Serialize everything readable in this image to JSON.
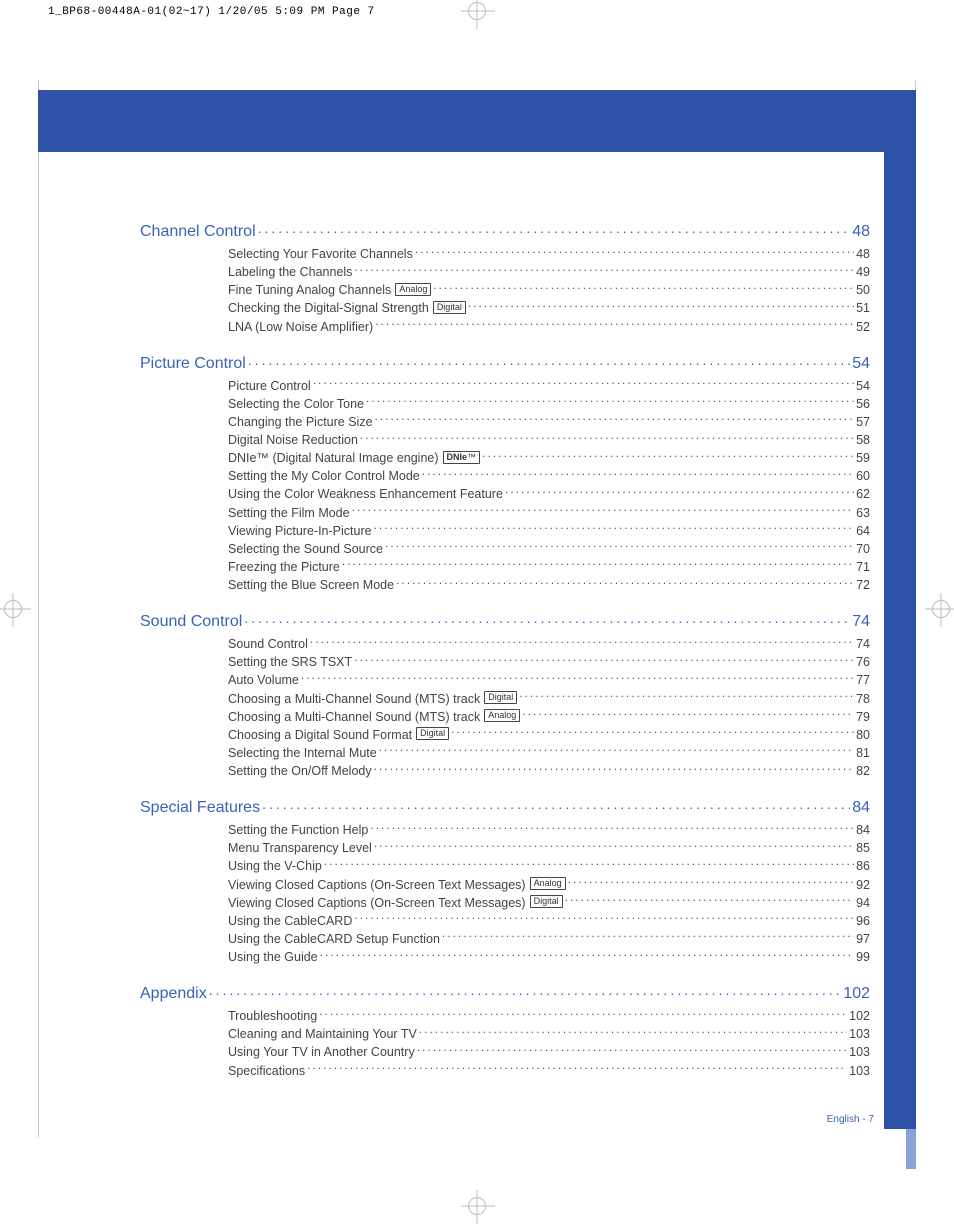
{
  "printHeader": "1_BP68-00448A-01(02~17)  1/20/05  5:09 PM  Page 7",
  "footer": "English - 7",
  "badges": {
    "analog": "Analog",
    "digital": "Digital",
    "dnie": "DNIe™"
  },
  "sections": [
    {
      "title": "Channel Control",
      "page": "48",
      "items": [
        {
          "title": "Selecting Your Favorite Channels",
          "page": "48"
        },
        {
          "title": "Labeling the Channels",
          "page": "49"
        },
        {
          "title": "Fine Tuning Analog Channels",
          "badge": "analog",
          "page": "50"
        },
        {
          "title": "Checking the Digital-Signal Strength",
          "badge": "digital",
          "page": "51"
        },
        {
          "title": "LNA (Low Noise Amplifier)",
          "page": "52"
        }
      ]
    },
    {
      "title": "Picture Control",
      "page": "54",
      "items": [
        {
          "title": "Picture Control",
          "page": "54"
        },
        {
          "title": "Selecting the Color Tone",
          "page": "56"
        },
        {
          "title": "Changing the Picture Size",
          "page": "57"
        },
        {
          "title": "Digital Noise Reduction",
          "page": "58"
        },
        {
          "title": "DNIe™ (Digital Natural Image engine)",
          "badge": "dnie",
          "page": "59"
        },
        {
          "title": "Setting the My Color Control Mode",
          "page": "60"
        },
        {
          "title": "Using the Color Weakness Enhancement Feature",
          "page": "62"
        },
        {
          "title": "Setting the Film Mode",
          "page": "63"
        },
        {
          "title": "Viewing Picture-In-Picture",
          "page": "64"
        },
        {
          "title": "Selecting the Sound Source",
          "page": "70"
        },
        {
          "title": "Freezing the Picture",
          "page": "71"
        },
        {
          "title": "Setting the Blue Screen Mode",
          "page": "72"
        }
      ]
    },
    {
      "title": "Sound Control",
      "page": "74",
      "items": [
        {
          "title": "Sound Control",
          "page": "74"
        },
        {
          "title": "Setting the SRS TSXT",
          "page": "76"
        },
        {
          "title": "Auto Volume",
          "page": "77"
        },
        {
          "title": "Choosing a Multi-Channel Sound (MTS) track",
          "badge": "digital",
          "page": "78"
        },
        {
          "title": "Choosing a Multi-Channel Sound (MTS) track",
          "badge": "analog",
          "page": "79"
        },
        {
          "title": "Choosing a Digital Sound Format",
          "badge": "digital",
          "page": "80"
        },
        {
          "title": "Selecting the Internal Mute",
          "page": "81"
        },
        {
          "title": "Setting the On/Off Melody",
          "page": "82"
        }
      ]
    },
    {
      "title": "Special Features",
      "page": "84",
      "items": [
        {
          "title": "Setting the Function Help",
          "page": "84"
        },
        {
          "title": "Menu Transparency Level",
          "page": "85"
        },
        {
          "title": "Using the V-Chip",
          "page": "86"
        },
        {
          "title": "Viewing Closed Captions (On-Screen Text Messages)",
          "badge": "analog",
          "page": "92"
        },
        {
          "title": "Viewing Closed Captions (On-Screen Text Messages)",
          "badge": "digital",
          "page": "94"
        },
        {
          "title": "Using the CableCARD",
          "page": "96"
        },
        {
          "title": "Using the CableCARD Setup Function",
          "page": "97"
        },
        {
          "title": "Using the Guide",
          "page": "99"
        }
      ]
    },
    {
      "title": "Appendix",
      "page": "102",
      "items": [
        {
          "title": "Troubleshooting",
          "page": "102"
        },
        {
          "title": "Cleaning and Maintaining Your TV",
          "page": "103"
        },
        {
          "title": "Using Your TV in Another Country",
          "page": "103"
        },
        {
          "title": "Specifications",
          "page": "103"
        }
      ]
    }
  ]
}
